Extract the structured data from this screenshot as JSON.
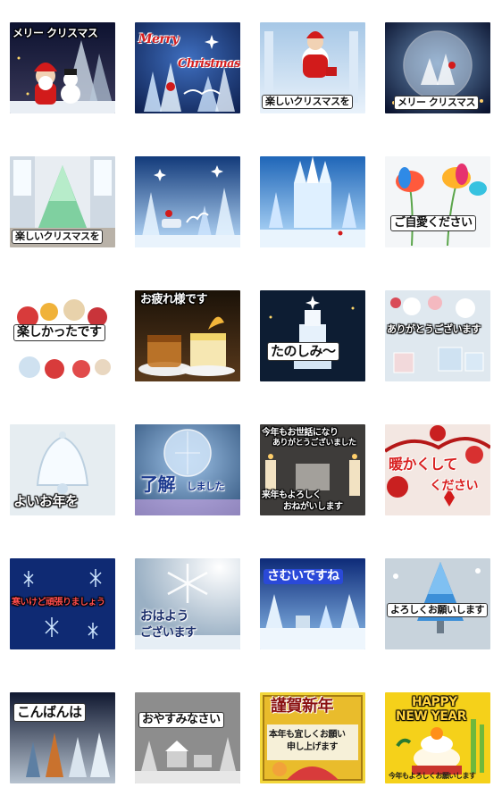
{
  "stickers": [
    {
      "id": "s1",
      "text": "メリー クリスマス"
    },
    {
      "id": "s2",
      "text": "Merry",
      "text2": "Christmas"
    },
    {
      "id": "s3",
      "text": "楽しいクリスマスを"
    },
    {
      "id": "s4",
      "text": "メリー クリスマス"
    },
    {
      "id": "s5",
      "text": "楽しいクリスマスを"
    },
    {
      "id": "s6",
      "text": ""
    },
    {
      "id": "s7",
      "text": ""
    },
    {
      "id": "s8",
      "text": "ご自愛ください"
    },
    {
      "id": "s9",
      "text": "楽しかったです"
    },
    {
      "id": "s10",
      "text": "お疲れ様です"
    },
    {
      "id": "s11",
      "text": "たのしみ～"
    },
    {
      "id": "s12",
      "text": "ありがとうございます"
    },
    {
      "id": "s13",
      "text": "よいお年を"
    },
    {
      "id": "s14",
      "text": "了解",
      "text2": "しました"
    },
    {
      "id": "s15",
      "text": "今年もお世話になり",
      "text2": "ありがとうございました",
      "text3": "来年もよろしく",
      "text4": "おねがいします"
    },
    {
      "id": "s16",
      "text": "暖かくして",
      "text2": "ください"
    },
    {
      "id": "s17",
      "text": "寒いけど頑張りましょう"
    },
    {
      "id": "s18",
      "text": "おはよう",
      "text2": "ございます"
    },
    {
      "id": "s19",
      "text": "さむいですね"
    },
    {
      "id": "s20",
      "text": "よろしくお願いします"
    },
    {
      "id": "s21",
      "text": "こんばんは"
    },
    {
      "id": "s22",
      "text": "おやすみなさい"
    },
    {
      "id": "s23",
      "text": "謹賀新年",
      "text2": "本年も宜しくお願い",
      "text3": "申し上げます"
    },
    {
      "id": "s24",
      "text": "HAPPY",
      "text2": "NEW YEAR",
      "text3": "今年もよろしくお願いします"
    }
  ],
  "colors": {
    "background": "#ffffff",
    "night_blue": "#0e1f55",
    "ice_blue": "#7fb6e8",
    "accent_red": "#d81f1f",
    "gold": "#ffd23c"
  }
}
